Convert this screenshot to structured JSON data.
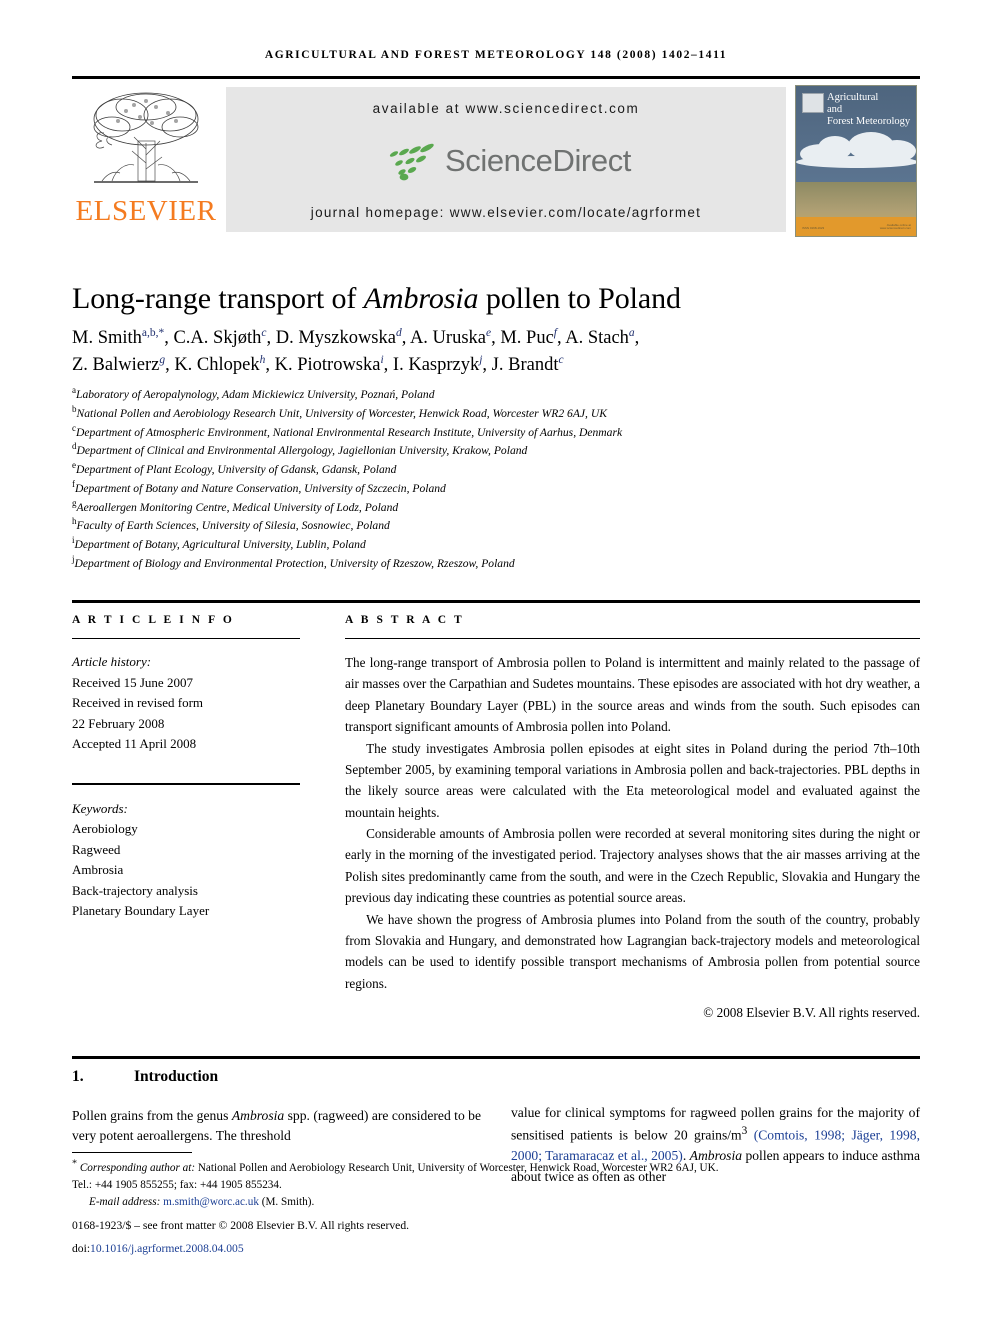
{
  "running_head": "Agricultural and Forest Meteorology 148 (2008) 1402–1411",
  "publisher": {
    "logo_word": "ELSEVIER",
    "logo_color": "#F47B20",
    "tree_icon": "elsevier-tree-icon"
  },
  "sciencedirect": {
    "available_at": "available at www.sciencedirect.com",
    "wordmark": "ScienceDirect",
    "journal_homepage": "journal homepage: www.elsevier.com/locate/agrformet",
    "logo_green": "#5aa84f",
    "wordmark_color": "#6f7271",
    "banner_bg": "#e6e6e6"
  },
  "cover": {
    "title_line1": "Agricultural",
    "title_line2": "and",
    "title_line3": "Forest Meteorology",
    "fineprint_left": "ISSN 0168-1923",
    "fineprint_right": "Available online at www.sciencedirect.com"
  },
  "article": {
    "title_part1": "Long-range transport of ",
    "title_italic": "Ambrosia",
    "title_part2": " pollen to Poland"
  },
  "authors": [
    {
      "name": "M. Smith",
      "sup": "a,b,*"
    },
    {
      "name": "C.A. Skjøth",
      "sup": "c"
    },
    {
      "name": "D. Myszkowska",
      "sup": "d"
    },
    {
      "name": "A. Uruska",
      "sup": "e"
    },
    {
      "name": "M. Puc",
      "sup": "f"
    },
    {
      "name": "A. Stach",
      "sup": "a"
    },
    {
      "name": "Z. Balwierz",
      "sup": "g"
    },
    {
      "name": "K. Chlopek",
      "sup": "h"
    },
    {
      "name": "K. Piotrowska",
      "sup": "i"
    },
    {
      "name": "I. Kasprzyk",
      "sup": "j"
    },
    {
      "name": "J. Brandt",
      "sup": "c"
    }
  ],
  "affiliations": [
    {
      "mark": "a",
      "text": "Laboratory of Aeropalynology, Adam Mickiewicz University, Poznań, Poland"
    },
    {
      "mark": "b",
      "text": "National Pollen and Aerobiology Research Unit, University of Worcester, Henwick Road, Worcester WR2 6AJ, UK"
    },
    {
      "mark": "c",
      "text": "Department of Atmospheric Environment, National Environmental Research Institute, University of Aarhus, Denmark"
    },
    {
      "mark": "d",
      "text": "Department of Clinical and Environmental Allergology, Jagiellonian University, Krakow, Poland"
    },
    {
      "mark": "e",
      "text": "Department of Plant Ecology, University of Gdansk, Gdansk, Poland"
    },
    {
      "mark": "f",
      "text": "Department of Botany and Nature Conservation, University of Szczecin, Poland"
    },
    {
      "mark": "g",
      "text": "Aeroallergen Monitoring Centre, Medical University of Lodz, Poland"
    },
    {
      "mark": "h",
      "text": "Faculty of Earth Sciences, University of Silesia, Sosnowiec, Poland"
    },
    {
      "mark": "i",
      "text": "Department of Botany, Agricultural University, Lublin, Poland"
    },
    {
      "mark": "j",
      "text": "Department of Biology and Environmental Protection, University of Rzeszow, Rzeszow, Poland"
    }
  ],
  "article_info": {
    "heading": "A R T I C L E   I N F O",
    "history_label": "Article history:",
    "received": "Received 15 June 2007",
    "revised_label": "Received in revised form",
    "revised_date": "22 February 2008",
    "accepted": "Accepted 11 April 2008",
    "keywords_label": "Keywords:",
    "keywords": [
      "Aerobiology",
      "Ragweed",
      "Ambrosia",
      "Back-trajectory analysis",
      "Planetary Boundary Layer"
    ]
  },
  "abstract": {
    "heading": "A B S T R A C T",
    "paragraphs": [
      "The long-range transport of Ambrosia pollen to Poland is intermittent and mainly related to the passage of air masses over the Carpathian and Sudetes mountains. These episodes are associated with hot dry weather, a deep Planetary Boundary Layer (PBL) in the source areas and winds from the south. Such episodes can transport significant amounts of Ambrosia pollen into Poland.",
      "The study investigates Ambrosia pollen episodes at eight sites in Poland during the period 7th–10th September 2005, by examining temporal variations in Ambrosia pollen and back-trajectories. PBL depths in the likely source areas were calculated with the Eta meteorological model and evaluated against the mountain heights.",
      "Considerable amounts of Ambrosia pollen were recorded at several monitoring sites during the night or early in the morning of the investigated period. Trajectory analyses shows that the air masses arriving at the Polish sites predominantly came from the south, and were in the Czech Republic, Slovakia and Hungary the previous day indicating these countries as potential source areas.",
      "We have shown the progress of Ambrosia plumes into Poland from the south of the country, probably from Slovakia and Hungary, and demonstrated how Lagrangian back-trajectory models and meteorological models can be used to identify possible transport mechanisms of Ambrosia pollen from potential source regions."
    ],
    "copyright": "© 2008 Elsevier B.V. All rights reserved."
  },
  "introduction": {
    "number": "1.",
    "title": "Introduction",
    "left_paragraph": "Pollen grains from the genus Ambrosia spp. (ragweed) are considered to be very potent aeroallergens. The threshold",
    "right_text_before": "value for clinical symptoms for ragweed pollen grains for the majority of sensitised patients is below 20 grains/m",
    "superscript": "3",
    "citation": "(Comtois, 1998; Jäger, 1998, 2000; Taramaracaz et al., 2005)",
    "right_text_after": ". Ambrosia pollen appears to induce asthma about twice as often as other"
  },
  "footnotes": {
    "corresponding_label": "Corresponding author at:",
    "corresponding_text": " National Pollen and Aerobiology Research Unit, University of Worcester, Henwick Road, Worcester WR2 6AJ, UK.",
    "tel_line": "Tel.: +44 1905 855255; fax: +44 1905 855234.",
    "email_label": "E-mail address:",
    "email": "m.smith@worc.ac.uk",
    "email_suffix": " (M. Smith).",
    "front_matter": "0168-1923/$ – see front matter © 2008 Elsevier B.V. All rights reserved.",
    "doi_label": "doi:",
    "doi_value": "10.1016/j.agrformet.2008.04.005",
    "link_color": "#1c3f94"
  }
}
